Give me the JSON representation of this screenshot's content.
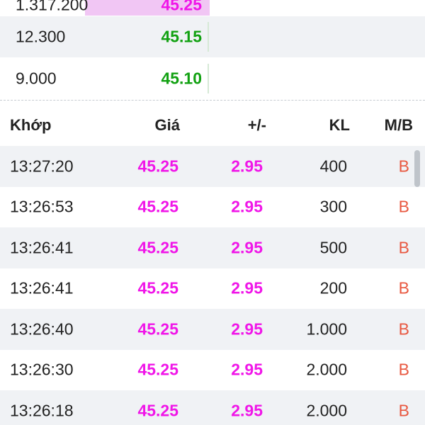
{
  "colors": {
    "ceiling": "#f016e8",
    "up": "#12a112",
    "buy": "#e8573f",
    "text": "#222222"
  },
  "order_book": {
    "rows": [
      {
        "volume": "1.317.200",
        "price": "45.25",
        "color": "#f016e8",
        "bar_ratio": 0.45,
        "partial": true
      },
      {
        "volume": "12.300",
        "price": "45.15",
        "color": "#12a112",
        "bar_ratio": 0,
        "partial": false
      },
      {
        "volume": "9.000",
        "price": "45.10",
        "color": "#12a112",
        "bar_ratio": 0,
        "partial": false
      }
    ]
  },
  "trades": {
    "headers": {
      "time": "Khớp",
      "price": "Giá",
      "change": "+/-",
      "volume": "KL",
      "side": "M/B"
    },
    "rows": [
      {
        "time": "13:27:20",
        "price": "45.25",
        "change": "2.95",
        "volume": "400",
        "side": "B"
      },
      {
        "time": "13:26:53",
        "price": "45.25",
        "change": "2.95",
        "volume": "300",
        "side": "B"
      },
      {
        "time": "13:26:41",
        "price": "45.25",
        "change": "2.95",
        "volume": "500",
        "side": "B"
      },
      {
        "time": "13:26:41",
        "price": "45.25",
        "change": "2.95",
        "volume": "200",
        "side": "B"
      },
      {
        "time": "13:26:40",
        "price": "45.25",
        "change": "2.95",
        "volume": "1.000",
        "side": "B"
      },
      {
        "time": "13:26:30",
        "price": "45.25",
        "change": "2.95",
        "volume": "2.000",
        "side": "B"
      },
      {
        "time": "13:26:18",
        "price": "45.25",
        "change": "2.95",
        "volume": "2.000",
        "side": "B"
      }
    ]
  }
}
